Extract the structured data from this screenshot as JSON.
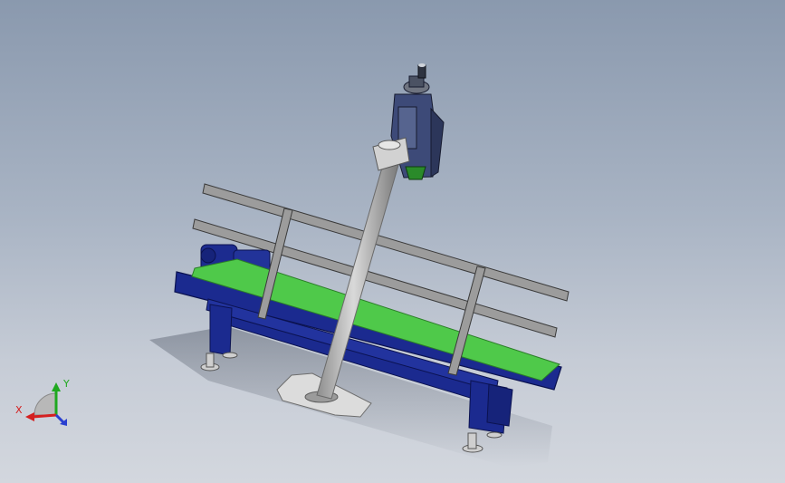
{
  "triad": {
    "x_label": "X",
    "y_label": "Y"
  },
  "colors": {
    "background_top": "#8a99ae",
    "background_bottom": "#d3d7de",
    "frame_blue": "#1b2a8f",
    "belt_green": "#4fc94a",
    "rail_gray": "#9a9a9a",
    "axis_x": "#d42020",
    "axis_y": "#1fa81f",
    "axis_z": "#2a40d0"
  },
  "icons": {
    "triad": "coordinate-triad-icon"
  }
}
